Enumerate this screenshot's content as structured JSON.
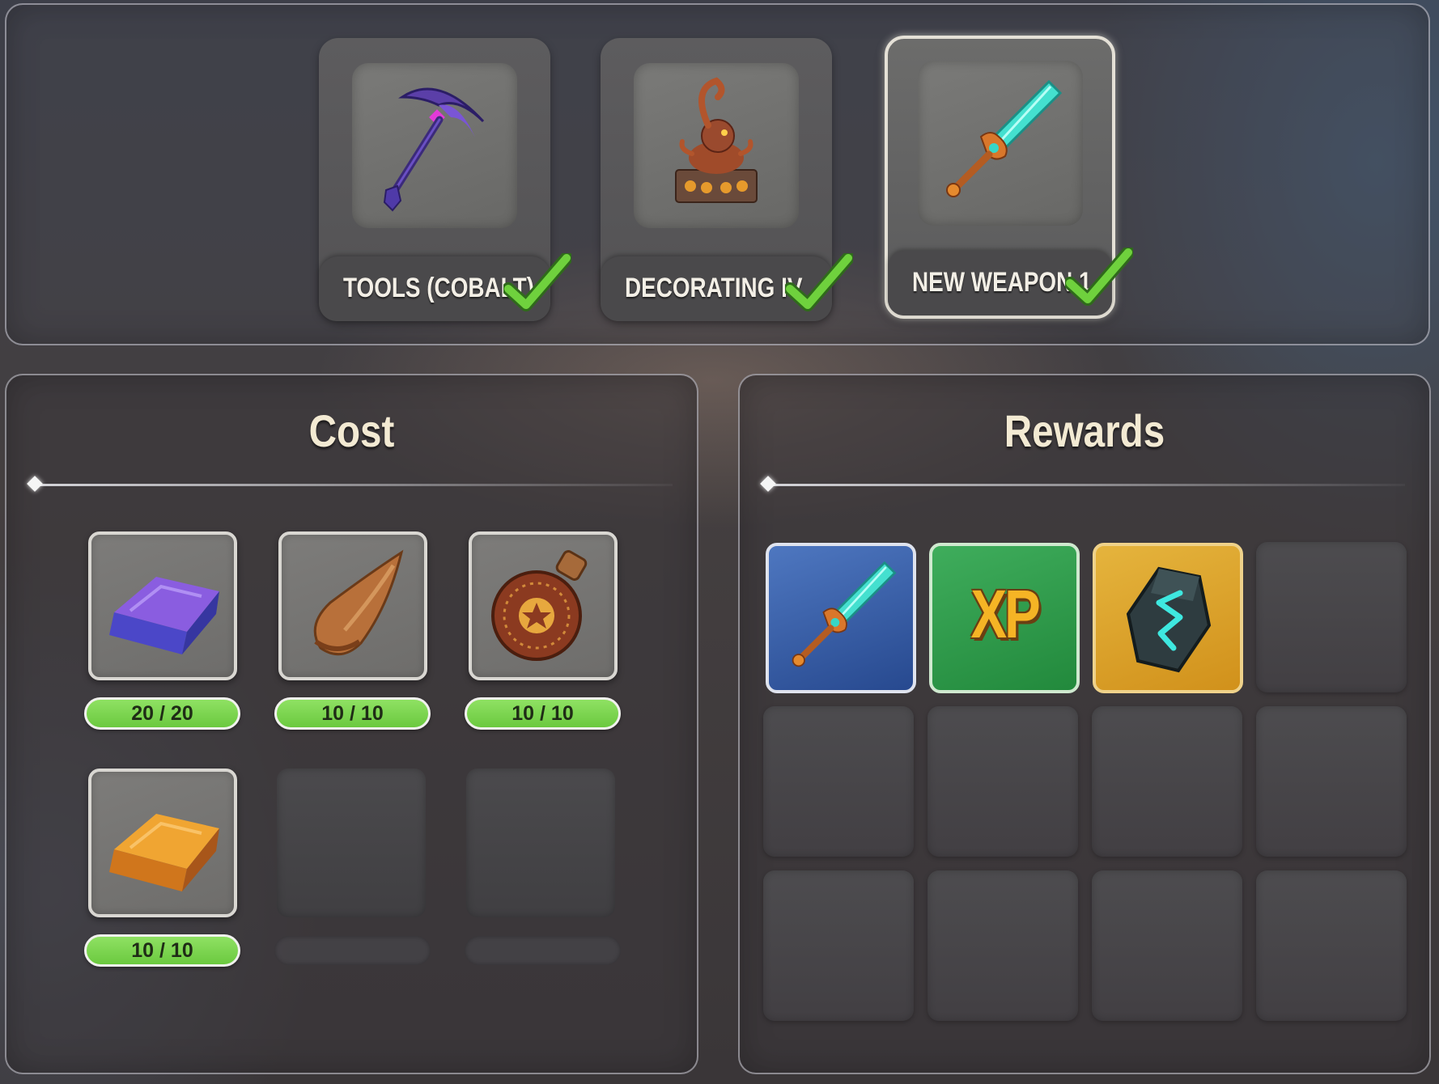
{
  "recipes": [
    {
      "label": "TOOLS (COBALT)",
      "icon": "pickaxe-icon",
      "completed": true,
      "selected": false
    },
    {
      "label": "DECORATING IV",
      "icon": "scorpion-statue-icon",
      "completed": true,
      "selected": false
    },
    {
      "label": "NEW WEAPON 1",
      "icon": "sword-icon",
      "completed": true,
      "selected": true
    }
  ],
  "cost": {
    "title": "Cost",
    "items": [
      {
        "icon": "cobalt-bar-icon",
        "count": "20 / 20"
      },
      {
        "icon": "horn-icon",
        "count": "10 / 10"
      },
      {
        "icon": "potion-icon",
        "count": "10 / 10"
      },
      {
        "icon": "copper-bar-icon",
        "count": "10 / 10"
      }
    ]
  },
  "rewards": {
    "title": "Rewards",
    "items": [
      {
        "icon": "sword-icon",
        "rarity_color": "#3a62ad"
      },
      {
        "icon": "xp-icon",
        "label": "XP",
        "rarity_color": "#2f9c4d"
      },
      {
        "icon": "rune-stone-icon",
        "rarity_color": "#dba42d"
      }
    ]
  },
  "colors": {
    "check_green": "#6fd13d",
    "count_pill": "#7ad44e",
    "title_text": "#f3ead3"
  }
}
